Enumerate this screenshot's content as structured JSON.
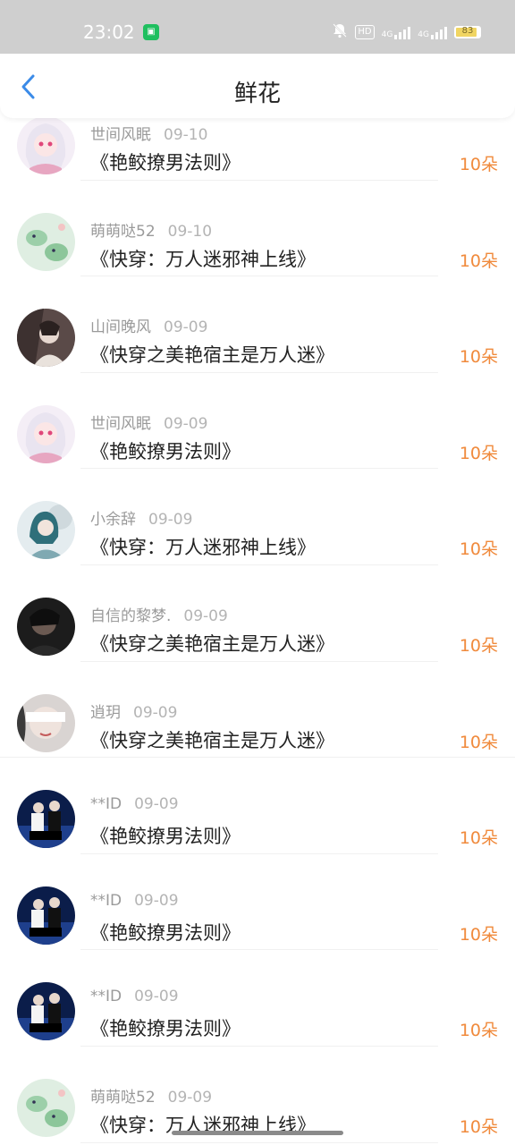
{
  "status": {
    "time": "23:02",
    "app_icon": "app-notification-icon",
    "hd_label": "HD",
    "net1": "4G",
    "net2": "4G",
    "battery_level": "83",
    "colors": {
      "bar": "#cfcfcf",
      "battery_fill": "#f1d562"
    }
  },
  "header": {
    "back_icon": "chevron-left-icon",
    "title": "鲜花",
    "accent_color": "#3b8be8"
  },
  "rows": [
    {
      "user": "世间风眠",
      "date": "09-10",
      "book": "《艳鲛撩男法则》",
      "count": "10朵",
      "avatar": "anime-white-hair"
    },
    {
      "user": "萌萌哒52",
      "date": "09-10",
      "book": "《快穿：万人迷邪神上线》",
      "count": "10朵",
      "avatar": "green-dinosaur"
    },
    {
      "user": "山间晚风",
      "date": "09-09",
      "book": "《快穿之美艳宿主是万人迷》",
      "count": "10朵",
      "avatar": "dark-fantasy"
    },
    {
      "user": "世间风眠",
      "date": "09-09",
      "book": "《艳鲛撩男法则》",
      "count": "10朵",
      "avatar": "anime-white-hair"
    },
    {
      "user": "小余辞",
      "date": "09-09",
      "book": "《快穿：万人迷邪神上线》",
      "count": "10朵",
      "avatar": "teal-hair-girl"
    },
    {
      "user": "自信的黎梦.",
      "date": "09-09",
      "book": "《快穿之美艳宿主是万人迷》",
      "count": "10朵",
      "avatar": "dark-portrait"
    },
    {
      "user": "逍玥",
      "date": "09-09",
      "book": "《快穿之美艳宿主是万人迷》",
      "count": "10朵",
      "avatar": "blindfold-portrait"
    },
    {
      "user": "**ID",
      "date": "09-09",
      "book": "《艳鲛撩男法则》",
      "count": "10朵",
      "avatar": "stage-duo"
    },
    {
      "user": "**ID",
      "date": "09-09",
      "book": "《艳鲛撩男法则》",
      "count": "10朵",
      "avatar": "stage-duo"
    },
    {
      "user": "**ID",
      "date": "09-09",
      "book": "《艳鲛撩男法则》",
      "count": "10朵",
      "avatar": "stage-duo"
    },
    {
      "user": "萌萌哒52",
      "date": "09-09",
      "book": "《快穿：万人迷邪神上线》",
      "count": "10朵",
      "avatar": "green-dinosaur"
    }
  ],
  "colors": {
    "count": "#f08a3c",
    "username": "#9a9a9a",
    "title": "#222222"
  }
}
